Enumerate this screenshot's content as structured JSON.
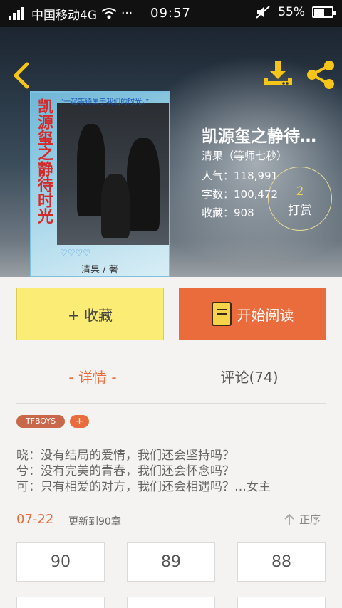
{
  "status_bar": {
    "carrier": "中国移动4G",
    "dots": "···",
    "time": "09:57",
    "battery": "55%"
  },
  "header": {
    "back_icon": "chevron-left-icon",
    "download_icon": "download-icon",
    "share_icon": "share-icon",
    "accent_color": "#f5c518"
  },
  "cover": {
    "vertical_title": "凯源玺之静待时光",
    "top_caption": "“一起等待属于我们的时光。”",
    "author_line": "清果 / 著",
    "hearts": "♡♡♡♡"
  },
  "book": {
    "title": "凯源玺之静待…",
    "author": "清果（等师七秒）",
    "popularity": "人气：118,991",
    "word_count": "字数：100,472",
    "favorites": "收藏：908"
  },
  "reward": {
    "count": "2",
    "label": "打赏"
  },
  "actions": {
    "collect_label": "+ 收藏",
    "read_label": "开始阅读"
  },
  "tabs": {
    "detail": "- 详情 -",
    "comments": "评论(74)"
  },
  "tags": [
    "TFBOYS",
    "+"
  ],
  "synopsis": [
    "晓：没有结局的爱情，我们还会坚持吗？",
    "兮：没有完美的青春，我们还会怀念吗？",
    "可：只有相爱的对方，我们还会相遇吗？…女主"
  ],
  "update": {
    "date": "07-22",
    "text": "更新到90章",
    "sort_label": "正序"
  },
  "chapters": [
    "90",
    "89",
    "88"
  ],
  "colors": {
    "orange": "#ea6b3c",
    "yellow_button": "#faec74"
  }
}
